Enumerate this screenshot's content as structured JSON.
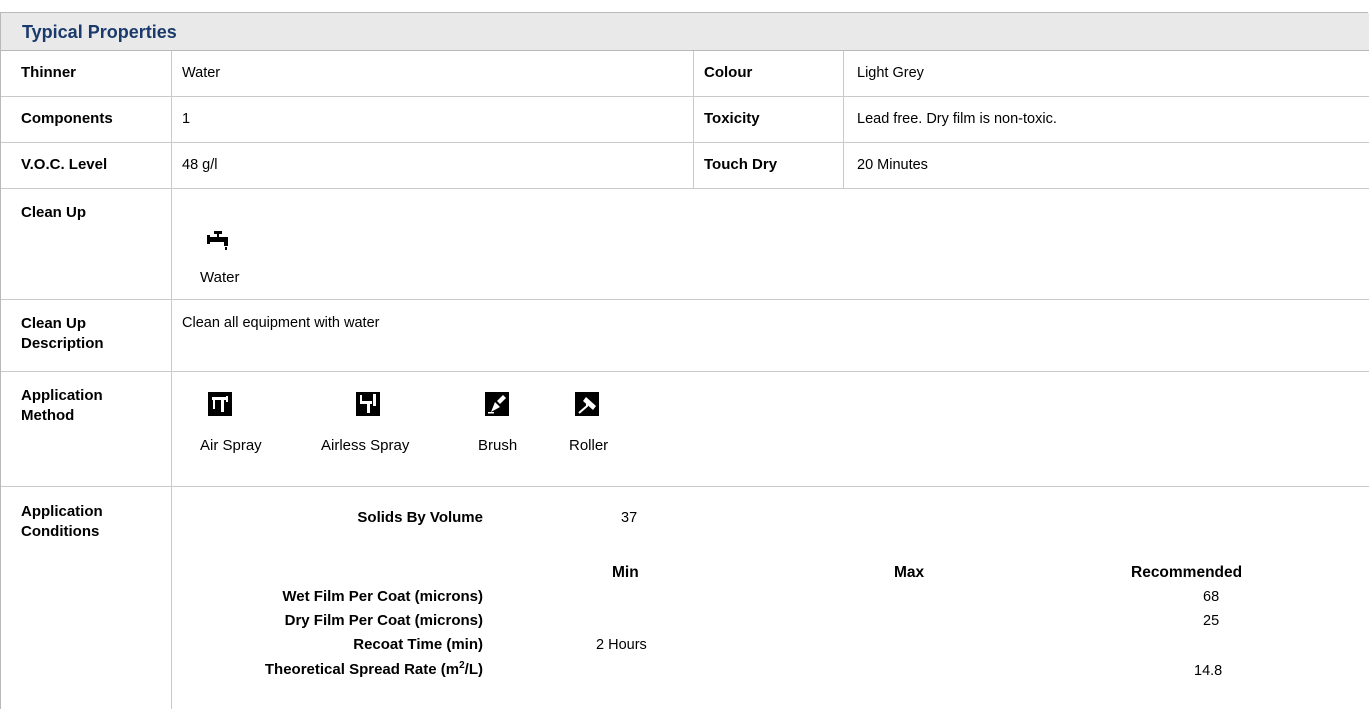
{
  "section": {
    "title": "Typical Properties"
  },
  "rows_top": [
    {
      "label": "Thinner",
      "value": "Water",
      "label2": "Colour",
      "value2": "Light Grey"
    },
    {
      "label": "Components",
      "value": "1",
      "label2": "Toxicity",
      "value2": "Lead free. Dry film is non-toxic."
    },
    {
      "label": "V.O.C. Level",
      "value": "48 g/l",
      "label2": "Touch Dry",
      "value2": "20 Minutes"
    }
  ],
  "clean_up": {
    "label": "Clean Up",
    "icon": "tap-icon",
    "caption": "Water"
  },
  "clean_up_desc": {
    "label_line1": "Clean Up",
    "label_line2": "Description",
    "value": "Clean all equipment with water"
  },
  "application_method": {
    "label_line1": "Application",
    "label_line2": "Method",
    "methods": [
      {
        "icon": "air-spray-icon",
        "caption": "Air Spray"
      },
      {
        "icon": "airless-spray-icon",
        "caption": "Airless Spray"
      },
      {
        "icon": "brush-icon",
        "caption": "Brush"
      },
      {
        "icon": "roller-icon",
        "caption": "Roller"
      }
    ]
  },
  "application_conditions": {
    "label_line1": "Application",
    "label_line2": "Conditions",
    "solids_label": "Solids By Volume",
    "solids_value": "37",
    "col_min": "Min",
    "col_max": "Max",
    "col_recommended": "Recommended",
    "rows": [
      {
        "label": "Wet Film Per Coat (microns)",
        "min": "",
        "max": "",
        "recommended": "68"
      },
      {
        "label": "Dry Film Per Coat (microns)",
        "min": "",
        "max": "",
        "recommended": "25"
      },
      {
        "label": "Recoat Time (min)",
        "min": "2 Hours",
        "max": "",
        "recommended": ""
      }
    ],
    "spread_label_pre": "Theoretical Spread Rate (m",
    "spread_label_sup": "2",
    "spread_label_post": "/L)",
    "spread_recommended": "14.8"
  }
}
